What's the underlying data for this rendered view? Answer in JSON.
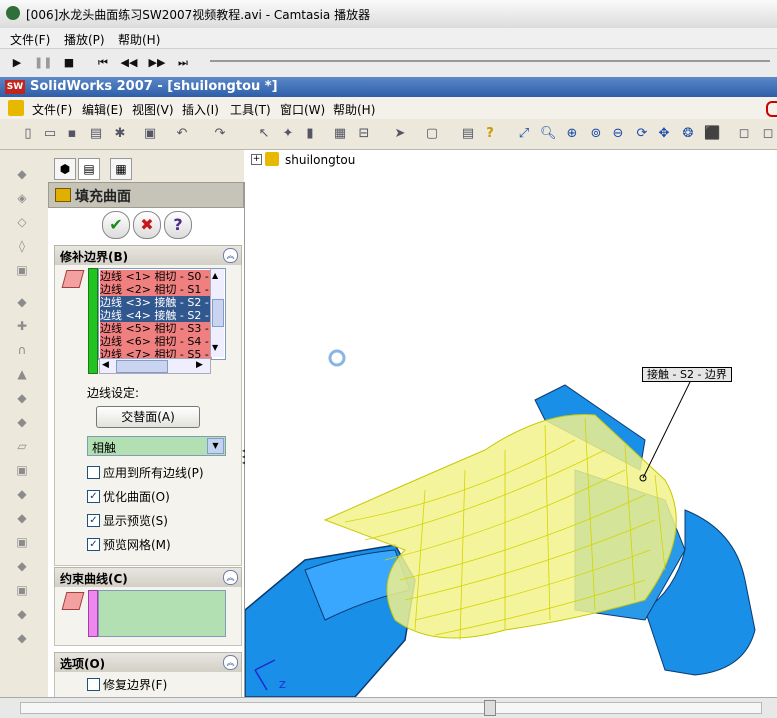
{
  "player": {
    "title": "[006]水龙头曲面练习SW2007视频教程.avi - Camtasia 播放器",
    "menu": [
      "文件(F)",
      "播放(P)",
      "帮助(H)"
    ]
  },
  "sw": {
    "logo": "SW",
    "title": "SolidWorks 2007 - [shuilongtou  *]",
    "menu": [
      "文件(F)",
      "编辑(E)",
      "视图(V)",
      "插入(I)",
      "工具(T)",
      "窗口(W)",
      "帮助(H)"
    ]
  },
  "pm": {
    "title": "填充曲面",
    "ok": "✔",
    "cancel": "✖",
    "help": "?",
    "patch_group": "修补边界(B)",
    "edges": [
      {
        "text": "边线 <1> 相切 - S0 - ",
        "state": "red"
      },
      {
        "text": "边线 <2> 相切 - S1 - ",
        "state": "red"
      },
      {
        "text": "边线 <3> 接触 - S2 - ",
        "state": "sel"
      },
      {
        "text": "边线 <4> 接触 - S2 - ",
        "state": "sel"
      },
      {
        "text": "边线 <5> 相切 - S3 - ",
        "state": "red"
      },
      {
        "text": "边线 <6> 相切 - S4 - ",
        "state": "red"
      },
      {
        "text": "边线 <7> 相切 - S5 - ",
        "state": "red"
      }
    ],
    "edge_setting_label": "边线设定:",
    "alt_face_button": "交替面(A)",
    "contact_select": "相触",
    "checks": [
      {
        "label": "应用到所有边线(P)",
        "checked": false
      },
      {
        "label": "优化曲面(O)",
        "checked": true
      },
      {
        "label": "显示预览(S)",
        "checked": true
      },
      {
        "label": "预览网格(M)",
        "checked": true
      }
    ],
    "constraint_group": "约束曲线(C)",
    "options_group": "选项(O)",
    "repair_label": "修复边界(F)"
  },
  "tree": {
    "root": "shuilongtou"
  },
  "callout": "接触 - S2 - 边界",
  "colors": {
    "part": "#1a8fe8",
    "mesh": "#e6e600",
    "list_red": "#f08080",
    "list_sel": "#31578f"
  }
}
